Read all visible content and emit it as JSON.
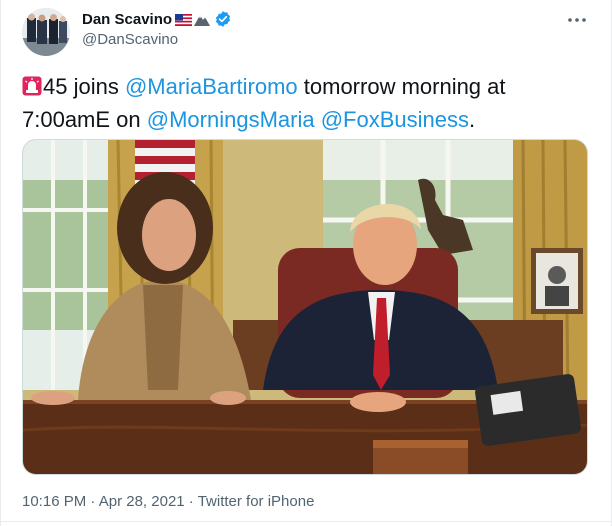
{
  "author": {
    "display_name": "Dan Scavino",
    "handle": "@DanScavino",
    "verified": true,
    "name_emojis": [
      "us-flag-emoji",
      "mountain-emoji"
    ]
  },
  "tweet": {
    "siren_emoji": "police-light-emoji",
    "text_parts": [
      {
        "type": "text",
        "value": "45 joins "
      },
      {
        "type": "link",
        "value": "@MariaBartiromo"
      },
      {
        "type": "text",
        "value": " tomorrow morning at 7:00amE on "
      },
      {
        "type": "link",
        "value": "@MorningsMaria"
      },
      {
        "type": "text",
        "value": " "
      },
      {
        "type": "link",
        "value": "@FoxBusiness"
      },
      {
        "type": "text",
        "value": "."
      }
    ]
  },
  "meta": {
    "time": "10:16 PM",
    "separator": " · ",
    "date": "Apr 28, 2021",
    "source": "Twitter for iPhone"
  },
  "colors": {
    "link": "#1b95e0",
    "verified": "#1d9bf0",
    "text": "#0f1419",
    "secondary": "#536471"
  }
}
